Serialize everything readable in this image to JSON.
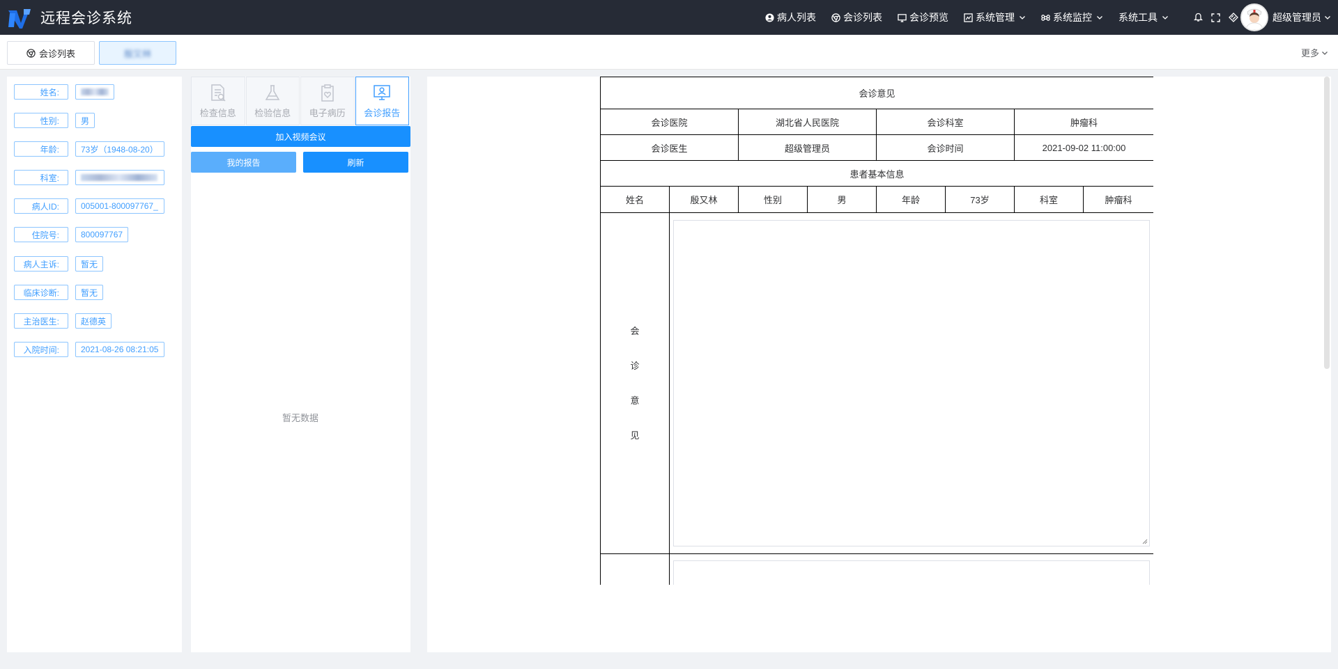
{
  "app": {
    "title": "远程会诊系统"
  },
  "nav": {
    "items": [
      {
        "label": "病人列表",
        "icon": "user-circle-icon"
      },
      {
        "label": "会诊列表",
        "icon": "chrome-icon"
      },
      {
        "label": "会诊预览",
        "icon": "monitor-icon"
      },
      {
        "label": "系统管理",
        "icon": "system-icon",
        "dropdown": true
      },
      {
        "label": "系统监控",
        "icon": "command-icon",
        "dropdown": true
      },
      {
        "label": "系统工具",
        "icon": "",
        "dropdown": true
      }
    ],
    "tool_icons": [
      "bell-icon",
      "fullscreen-icon",
      "layout-icon",
      "refresh-icon"
    ],
    "user": "超级管理员"
  },
  "tags": {
    "items": [
      {
        "label": "会诊列表",
        "icon": "chrome-icon",
        "active": false
      },
      {
        "label": "殷又林",
        "active": true
      }
    ],
    "more": "更多"
  },
  "patient": {
    "fields": [
      {
        "label": "姓名:",
        "value": ""
      },
      {
        "label": "性别:",
        "value": "男"
      },
      {
        "label": "年龄:",
        "value": "73岁（1948-08-20）"
      },
      {
        "label": "科室:",
        "value": ""
      },
      {
        "label": "病人ID:",
        "value": "005001-800097767_"
      },
      {
        "label": "住院号:",
        "value": "800097767"
      },
      {
        "label": "病人主诉:",
        "value": "暂无"
      },
      {
        "label": "临床诊断:",
        "value": "暂无"
      },
      {
        "label": "主治医生:",
        "value": "赵德英"
      },
      {
        "label": "入院时间:",
        "value": "2021-08-26 08:21:05"
      }
    ]
  },
  "middle": {
    "tabs": [
      {
        "label": "检查信息",
        "icon": "doc-search-icon"
      },
      {
        "label": "检验信息",
        "icon": "flask-icon"
      },
      {
        "label": "电子病历",
        "icon": "clipboard-heart-icon"
      },
      {
        "label": "会诊报告",
        "icon": "monitor-user-icon",
        "active": true
      }
    ],
    "join_video": "加入视频会议",
    "my_report": "我的报告",
    "refresh": "刷新",
    "empty": "暂无数据"
  },
  "report": {
    "title": "会诊意见",
    "hospital_label": "会诊医院",
    "hospital": "湖北省人民医院",
    "dept_label": "会诊科室",
    "dept": "肿瘤科",
    "doctor_label": "会诊医生",
    "doctor": "超级管理员",
    "time_label": "会诊时间",
    "time": "2021-09-02 11:00:00",
    "basic_info": "患者基本信息",
    "name_label": "姓名",
    "name": "殷又林",
    "gender_label": "性别",
    "gender": "男",
    "age_label": "年龄",
    "age": "73岁",
    "dept2_label": "科室",
    "dept2": "肿瘤科",
    "opinion_chars": [
      "会",
      "诊",
      "意",
      "见"
    ]
  }
}
